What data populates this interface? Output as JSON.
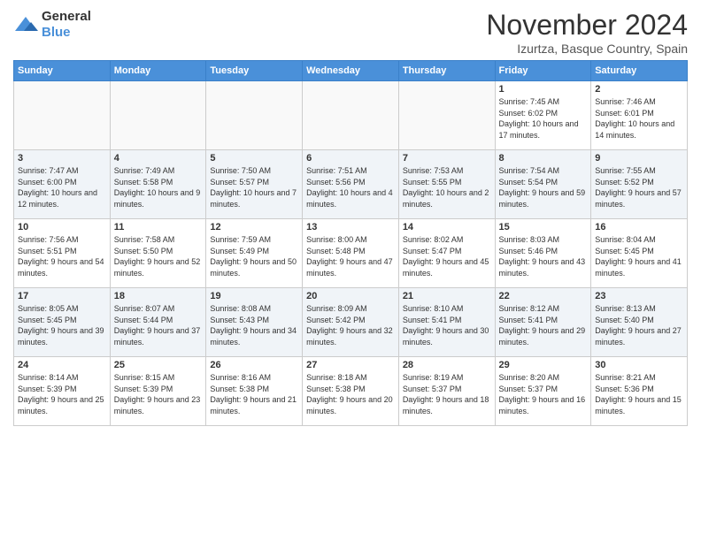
{
  "header": {
    "logo_line1": "General",
    "logo_line2": "Blue",
    "month": "November 2024",
    "location": "Izurtza, Basque Country, Spain"
  },
  "days_of_week": [
    "Sunday",
    "Monday",
    "Tuesday",
    "Wednesday",
    "Thursday",
    "Friday",
    "Saturday"
  ],
  "weeks": [
    [
      {
        "day": "",
        "info": ""
      },
      {
        "day": "",
        "info": ""
      },
      {
        "day": "",
        "info": ""
      },
      {
        "day": "",
        "info": ""
      },
      {
        "day": "",
        "info": ""
      },
      {
        "day": "1",
        "info": "Sunrise: 7:45 AM\nSunset: 6:02 PM\nDaylight: 10 hours and 17 minutes."
      },
      {
        "day": "2",
        "info": "Sunrise: 7:46 AM\nSunset: 6:01 PM\nDaylight: 10 hours and 14 minutes."
      }
    ],
    [
      {
        "day": "3",
        "info": "Sunrise: 7:47 AM\nSunset: 6:00 PM\nDaylight: 10 hours and 12 minutes."
      },
      {
        "day": "4",
        "info": "Sunrise: 7:49 AM\nSunset: 5:58 PM\nDaylight: 10 hours and 9 minutes."
      },
      {
        "day": "5",
        "info": "Sunrise: 7:50 AM\nSunset: 5:57 PM\nDaylight: 10 hours and 7 minutes."
      },
      {
        "day": "6",
        "info": "Sunrise: 7:51 AM\nSunset: 5:56 PM\nDaylight: 10 hours and 4 minutes."
      },
      {
        "day": "7",
        "info": "Sunrise: 7:53 AM\nSunset: 5:55 PM\nDaylight: 10 hours and 2 minutes."
      },
      {
        "day": "8",
        "info": "Sunrise: 7:54 AM\nSunset: 5:54 PM\nDaylight: 9 hours and 59 minutes."
      },
      {
        "day": "9",
        "info": "Sunrise: 7:55 AM\nSunset: 5:52 PM\nDaylight: 9 hours and 57 minutes."
      }
    ],
    [
      {
        "day": "10",
        "info": "Sunrise: 7:56 AM\nSunset: 5:51 PM\nDaylight: 9 hours and 54 minutes."
      },
      {
        "day": "11",
        "info": "Sunrise: 7:58 AM\nSunset: 5:50 PM\nDaylight: 9 hours and 52 minutes."
      },
      {
        "day": "12",
        "info": "Sunrise: 7:59 AM\nSunset: 5:49 PM\nDaylight: 9 hours and 50 minutes."
      },
      {
        "day": "13",
        "info": "Sunrise: 8:00 AM\nSunset: 5:48 PM\nDaylight: 9 hours and 47 minutes."
      },
      {
        "day": "14",
        "info": "Sunrise: 8:02 AM\nSunset: 5:47 PM\nDaylight: 9 hours and 45 minutes."
      },
      {
        "day": "15",
        "info": "Sunrise: 8:03 AM\nSunset: 5:46 PM\nDaylight: 9 hours and 43 minutes."
      },
      {
        "day": "16",
        "info": "Sunrise: 8:04 AM\nSunset: 5:45 PM\nDaylight: 9 hours and 41 minutes."
      }
    ],
    [
      {
        "day": "17",
        "info": "Sunrise: 8:05 AM\nSunset: 5:45 PM\nDaylight: 9 hours and 39 minutes."
      },
      {
        "day": "18",
        "info": "Sunrise: 8:07 AM\nSunset: 5:44 PM\nDaylight: 9 hours and 37 minutes."
      },
      {
        "day": "19",
        "info": "Sunrise: 8:08 AM\nSunset: 5:43 PM\nDaylight: 9 hours and 34 minutes."
      },
      {
        "day": "20",
        "info": "Sunrise: 8:09 AM\nSunset: 5:42 PM\nDaylight: 9 hours and 32 minutes."
      },
      {
        "day": "21",
        "info": "Sunrise: 8:10 AM\nSunset: 5:41 PM\nDaylight: 9 hours and 30 minutes."
      },
      {
        "day": "22",
        "info": "Sunrise: 8:12 AM\nSunset: 5:41 PM\nDaylight: 9 hours and 29 minutes."
      },
      {
        "day": "23",
        "info": "Sunrise: 8:13 AM\nSunset: 5:40 PM\nDaylight: 9 hours and 27 minutes."
      }
    ],
    [
      {
        "day": "24",
        "info": "Sunrise: 8:14 AM\nSunset: 5:39 PM\nDaylight: 9 hours and 25 minutes."
      },
      {
        "day": "25",
        "info": "Sunrise: 8:15 AM\nSunset: 5:39 PM\nDaylight: 9 hours and 23 minutes."
      },
      {
        "day": "26",
        "info": "Sunrise: 8:16 AM\nSunset: 5:38 PM\nDaylight: 9 hours and 21 minutes."
      },
      {
        "day": "27",
        "info": "Sunrise: 8:18 AM\nSunset: 5:38 PM\nDaylight: 9 hours and 20 minutes."
      },
      {
        "day": "28",
        "info": "Sunrise: 8:19 AM\nSunset: 5:37 PM\nDaylight: 9 hours and 18 minutes."
      },
      {
        "day": "29",
        "info": "Sunrise: 8:20 AM\nSunset: 5:37 PM\nDaylight: 9 hours and 16 minutes."
      },
      {
        "day": "30",
        "info": "Sunrise: 8:21 AM\nSunset: 5:36 PM\nDaylight: 9 hours and 15 minutes."
      }
    ]
  ]
}
